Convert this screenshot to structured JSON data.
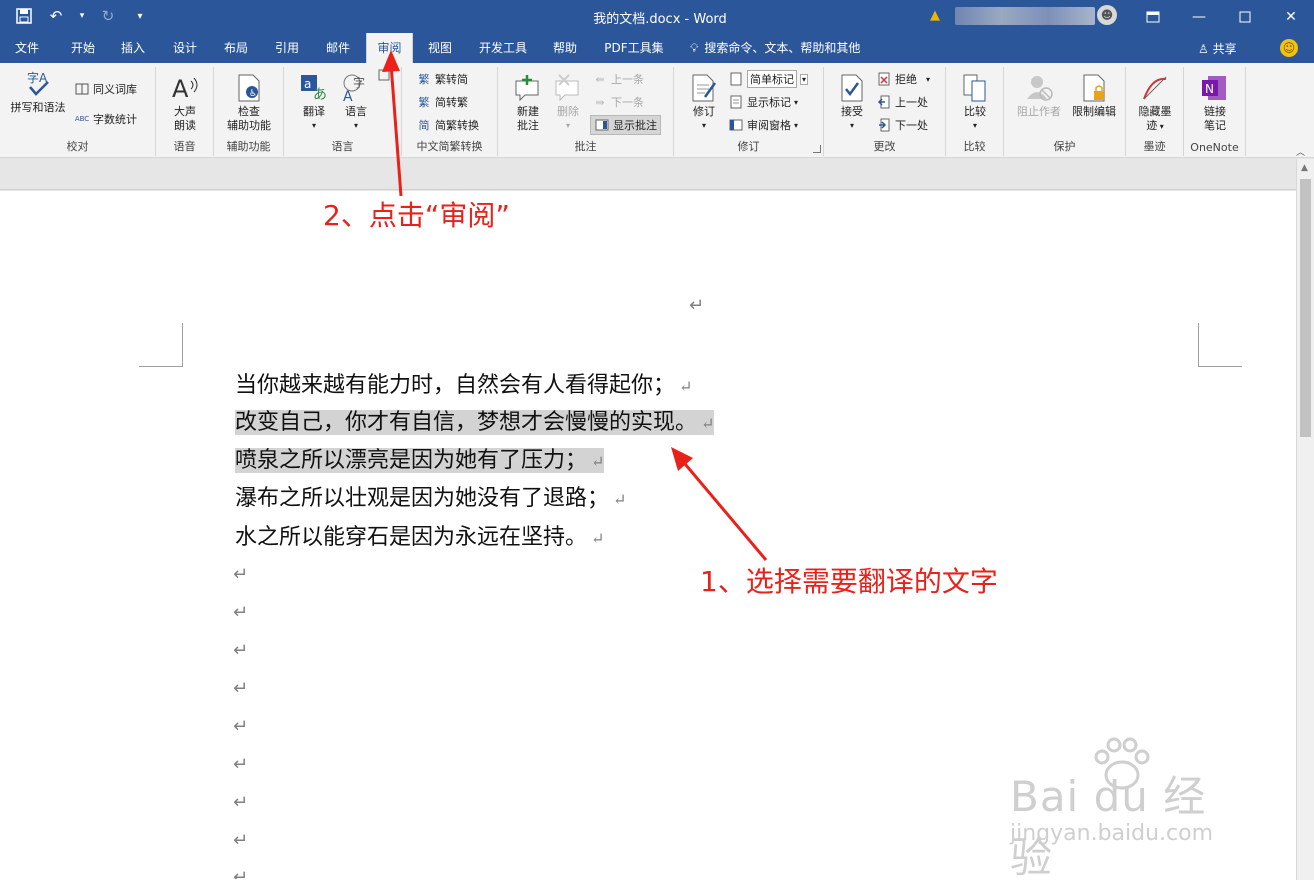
{
  "window": {
    "title": "我的文档.docx - Word",
    "controls": [
      "restore-ribbon",
      "minimize",
      "maximize",
      "close"
    ]
  },
  "qat": {
    "save": "save",
    "undo": "undo",
    "redo": "redo",
    "customize": "▾"
  },
  "tabs": [
    {
      "label": "文件"
    },
    {
      "label": "开始"
    },
    {
      "label": "插入"
    },
    {
      "label": "设计"
    },
    {
      "label": "布局"
    },
    {
      "label": "引用"
    },
    {
      "label": "邮件"
    },
    {
      "label": "审阅"
    },
    {
      "label": "视图"
    },
    {
      "label": "开发工具"
    },
    {
      "label": "帮助"
    },
    {
      "label": "PDF工具集"
    }
  ],
  "active_tab": "审阅",
  "search_label": "搜索命令、文本、帮助和其他",
  "share_label": "共享",
  "ribbon": {
    "proofing": {
      "label": "校对",
      "spelling": "拼写和语法",
      "thesaurus": "同义词库",
      "wordcount": "字数统计"
    },
    "speech": {
      "label": "语音",
      "readaloud": "大声\n朗读",
      "readaloud_1": "大声",
      "readaloud_2": "朗读"
    },
    "accessibility": {
      "label": "辅助功能",
      "check_1": "检查",
      "check_2": "辅助功能"
    },
    "language": {
      "label": "语言",
      "translate": "翻译",
      "language": "语言"
    },
    "chinese": {
      "label": "中文简繁转换",
      "t2s": "繁转简",
      "s2t": "简转繁",
      "convert": "简繁转换"
    },
    "comments": {
      "label": "批注",
      "new_1": "新建",
      "new_2": "批注",
      "delete": "删除",
      "prev": "上一条",
      "next": "下一条",
      "show": "显示批注"
    },
    "tracking": {
      "label": "修订",
      "track": "修订",
      "markup": "简单标记",
      "show_markup": "显示标记",
      "pane": "审阅窗格"
    },
    "changes": {
      "label": "更改",
      "accept": "接受",
      "reject": "拒绝",
      "prev": "上一处",
      "next": "下一处"
    },
    "compare": {
      "label": "比较",
      "compare": "比较"
    },
    "protect": {
      "label": "保护",
      "block_1": "阻止作者",
      "restrict": "限制编辑"
    },
    "ink": {
      "label": "墨迹",
      "hide_1": "隐藏墨",
      "hide_2": "迹"
    },
    "onenote": {
      "label": "OneNote",
      "link_1": "链接",
      "link_2": "笔记"
    }
  },
  "document": {
    "lines": [
      "当你越来越有能力时，自然会有人看得起你；",
      "改变自己，你才有自信，梦想才会慢慢的实现。",
      "喷泉之所以漂亮是因为她有了压力；",
      "瀑布之所以壮观是因为她没有了退路；",
      "水之所以能穿石是因为永远在坚持。"
    ],
    "selected_line_indices": [
      1,
      2
    ],
    "paragraph_mark": "↵"
  },
  "annotations": {
    "step1": "1、选择需要翻译的文字",
    "step2": "2、点击“审阅”",
    "color": "#e8221b"
  },
  "watermark": {
    "main": "Bai du 经验",
    "sub": "jingyan.baidu.com"
  },
  "colors": {
    "word_blue": "#2b579a",
    "ribbon_bg": "#f3f3f3",
    "selection": "#d3d3d3"
  }
}
